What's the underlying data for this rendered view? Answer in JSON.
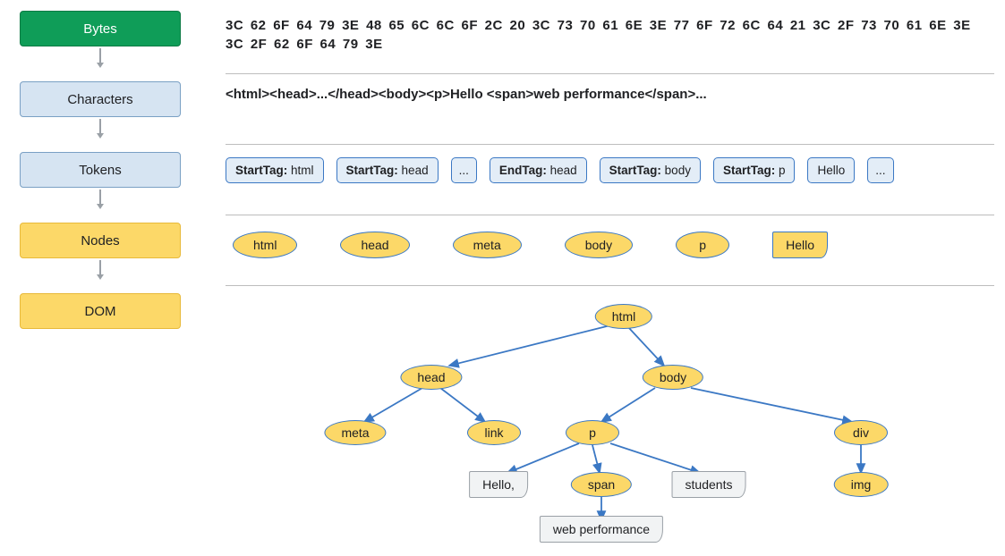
{
  "stages": {
    "bytes": "Bytes",
    "characters": "Characters",
    "tokens": "Tokens",
    "nodes": "Nodes",
    "dom": "DOM"
  },
  "bytes_text": "3C 62 6F 64 79 3E 48 65 6C 6C 6F 2C 20 3C 73 70 61 6E 3E 77 6F 72 6C 64 21 3C 2F 73 70 61 6E 3E 3C 2F 62 6F 64 79 3E",
  "characters_text": "<html><head>...</head><body><p>Hello <span>web performance</span>...",
  "tokens": [
    {
      "label": "StartTag:",
      "value": " html"
    },
    {
      "label": "StartTag:",
      "value": " head"
    },
    {
      "label": "",
      "value": "..."
    },
    {
      "label": "EndTag:",
      "value": " head"
    },
    {
      "label": "StartTag:",
      "value": " body"
    },
    {
      "label": "StartTag:",
      "value": " p"
    },
    {
      "label": "",
      "value": "Hello"
    },
    {
      "label": "",
      "value": "..."
    }
  ],
  "nodes_list": {
    "n0": "html",
    "n1": "head",
    "n2": "meta",
    "n3": "body",
    "n4": "p",
    "n5": "Hello"
  },
  "tree": {
    "html": "html",
    "head": "head",
    "body": "body",
    "meta": "meta",
    "link": "link",
    "p": "p",
    "div": "div",
    "hello": "Hello,",
    "span": "span",
    "students": "students",
    "img": "img",
    "webperf": "web performance"
  }
}
